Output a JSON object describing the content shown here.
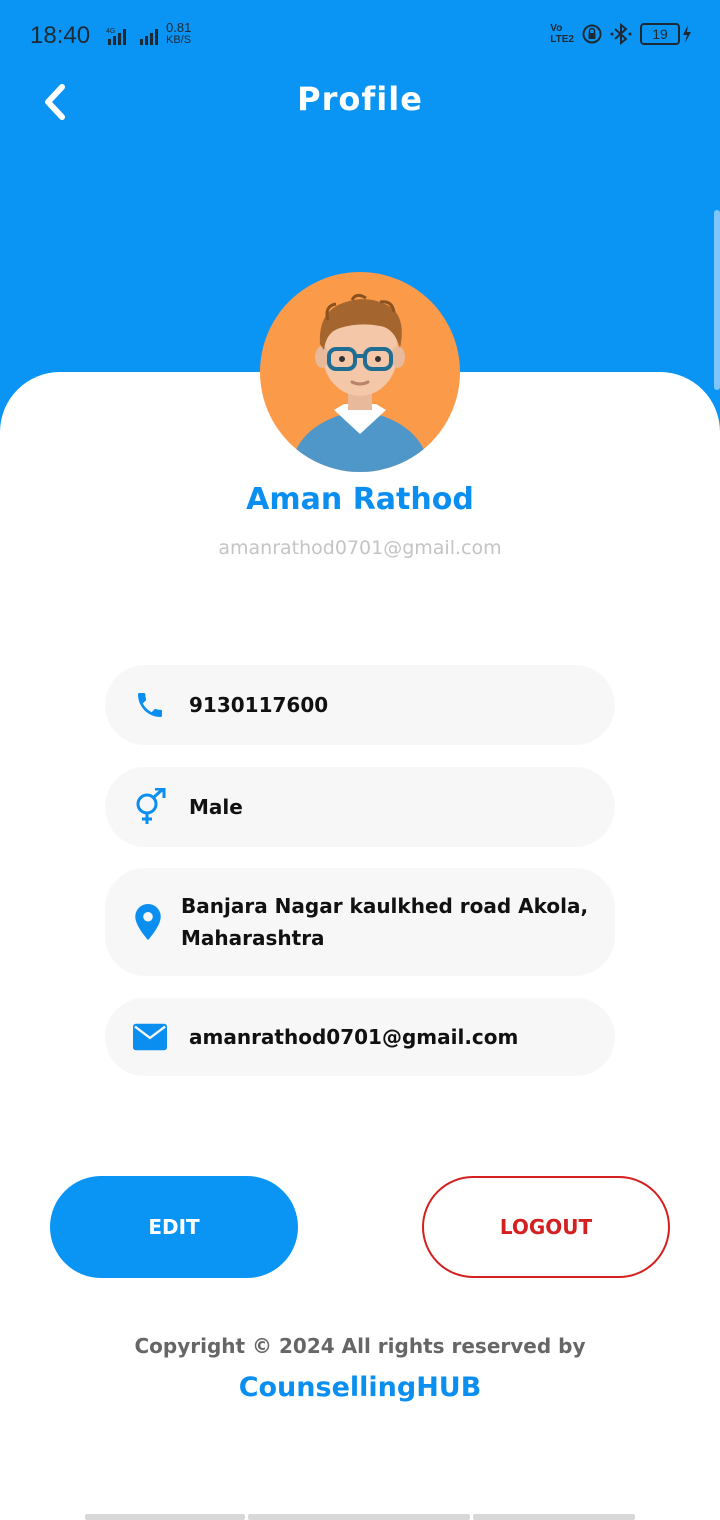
{
  "status_bar": {
    "time": "18:40",
    "net_speed_value": "0.81",
    "net_speed_unit": "KB/S",
    "volte_top": "Vo",
    "volte_bottom": "LTE2",
    "battery": "19"
  },
  "header": {
    "title": "Profile"
  },
  "profile": {
    "name": "Aman Rathod",
    "email": "amanrathod0701@gmail.com"
  },
  "details": {
    "phone": "9130117600",
    "gender": "Male",
    "address_line1": "Banjara Nagar kaulkhed road Akola,",
    "address_line2": "Maharashtra",
    "email": "amanrathod0701@gmail.com"
  },
  "actions": {
    "edit_label": "EDIT",
    "logout_label": "LOGOUT"
  },
  "footer": {
    "copyright": "Copyright © 2024 All rights reserved by",
    "brand": "CounsellingHUB"
  },
  "colors": {
    "primary": "#0a95f5",
    "logout": "#d42020",
    "avatar_bg": "#fb9a48"
  },
  "icons": {
    "back": "chevron-left-icon",
    "phone": "phone-icon",
    "gender": "gender-icon",
    "address": "location-pin-icon",
    "email": "envelope-icon"
  }
}
